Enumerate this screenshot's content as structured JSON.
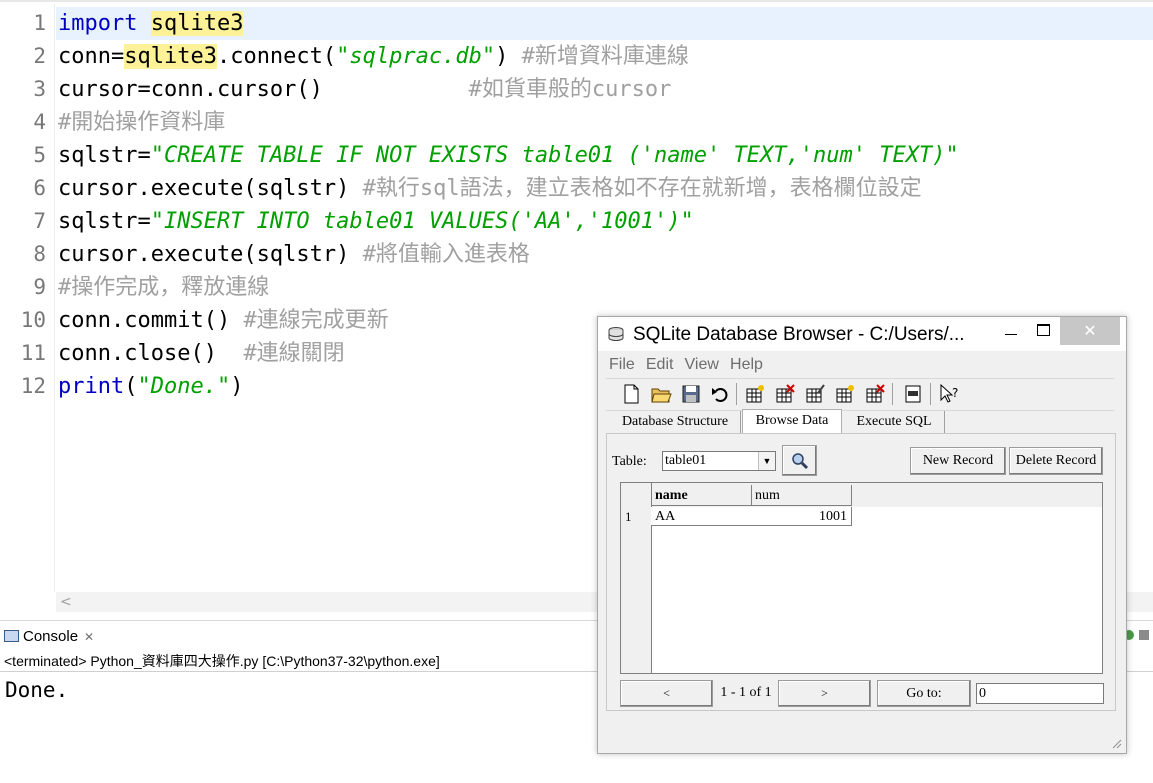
{
  "editor": {
    "line_numbers": [
      "1",
      "2",
      "3",
      "4",
      "5",
      "6",
      "7",
      "8",
      "9",
      "10",
      "11",
      "12"
    ],
    "lines": [
      [
        {
          "t": "import",
          "c": "kw"
        },
        {
          "t": " "
        },
        {
          "t": "sqlite3",
          "c": "hl"
        }
      ],
      [
        {
          "t": "conn="
        },
        {
          "t": "sqlite3",
          "c": "hl"
        },
        {
          "t": ".connect("
        },
        {
          "t": "\"sqlprac.db\"",
          "c": "str"
        },
        {
          "t": ") "
        },
        {
          "t": "#新增資料庫連線",
          "c": "cm"
        }
      ],
      [
        {
          "t": "cursor=conn.cursor()           "
        },
        {
          "t": "#如貨車般的cursor",
          "c": "cm"
        }
      ],
      [
        {
          "t": "#開始操作資料庫",
          "c": "cm"
        }
      ],
      [
        {
          "t": "sqlstr="
        },
        {
          "t": "\"CREATE TABLE IF NOT EXISTS table01 ('name' TEXT,'num' TEXT)\"",
          "c": "str"
        }
      ],
      [
        {
          "t": "cursor.execute(sqlstr) "
        },
        {
          "t": "#執行sql語法，建立表格如不存在就新增，表格欄位設定",
          "c": "cm"
        }
      ],
      [
        {
          "t": "sqlstr="
        },
        {
          "t": "\"INSERT INTO table01 VALUES('AA','1001')\"",
          "c": "str"
        }
      ],
      [
        {
          "t": "cursor.execute(sqlstr) "
        },
        {
          "t": "#將值輸入進表格",
          "c": "cm"
        }
      ],
      [
        {
          "t": "#操作完成，釋放連線",
          "c": "cm"
        }
      ],
      [
        {
          "t": "conn.commit() "
        },
        {
          "t": "#連線完成更新",
          "c": "cm"
        }
      ],
      [
        {
          "t": "conn.close()  "
        },
        {
          "t": "#連線關閉",
          "c": "cm"
        }
      ],
      [
        {
          "t": "print",
          "c": "kw"
        },
        {
          "t": "("
        },
        {
          "t": "\"Done.\"",
          "c": "str"
        },
        {
          "t": ")"
        }
      ]
    ],
    "scroll_left_glyph": "<"
  },
  "console": {
    "tab_label": "Console",
    "close_glyph": "✕",
    "status": "<terminated> Python_資料庫四大操作.py [C:\\Python37-32\\python.exe]",
    "output": "Done."
  },
  "sqlite_window": {
    "title": "SQLite Database Browser - C:/Users/...",
    "menu": [
      "File",
      "Edit",
      "View",
      "Help"
    ],
    "tabs": [
      "Database Structure",
      "Browse Data",
      "Execute SQL"
    ],
    "active_tab": "Browse Data",
    "table_label": "Table:",
    "table_selected": "table01",
    "new_record_label": "New Record",
    "delete_record_label": "Delete Record",
    "columns": [
      "name",
      "num"
    ],
    "rows": [
      {
        "row": "1",
        "name": "AA",
        "num": "1001"
      }
    ],
    "prev_label": "<",
    "next_label": ">",
    "page_info": "1 - 1 of 1",
    "goto_label": "Go to:",
    "goto_value": "0"
  },
  "colors": {
    "keyword": "#0000c0",
    "string": "#00a000",
    "comment": "#a0a0a0",
    "highlight": "#fef299",
    "current_line": "#e8f2fe"
  }
}
